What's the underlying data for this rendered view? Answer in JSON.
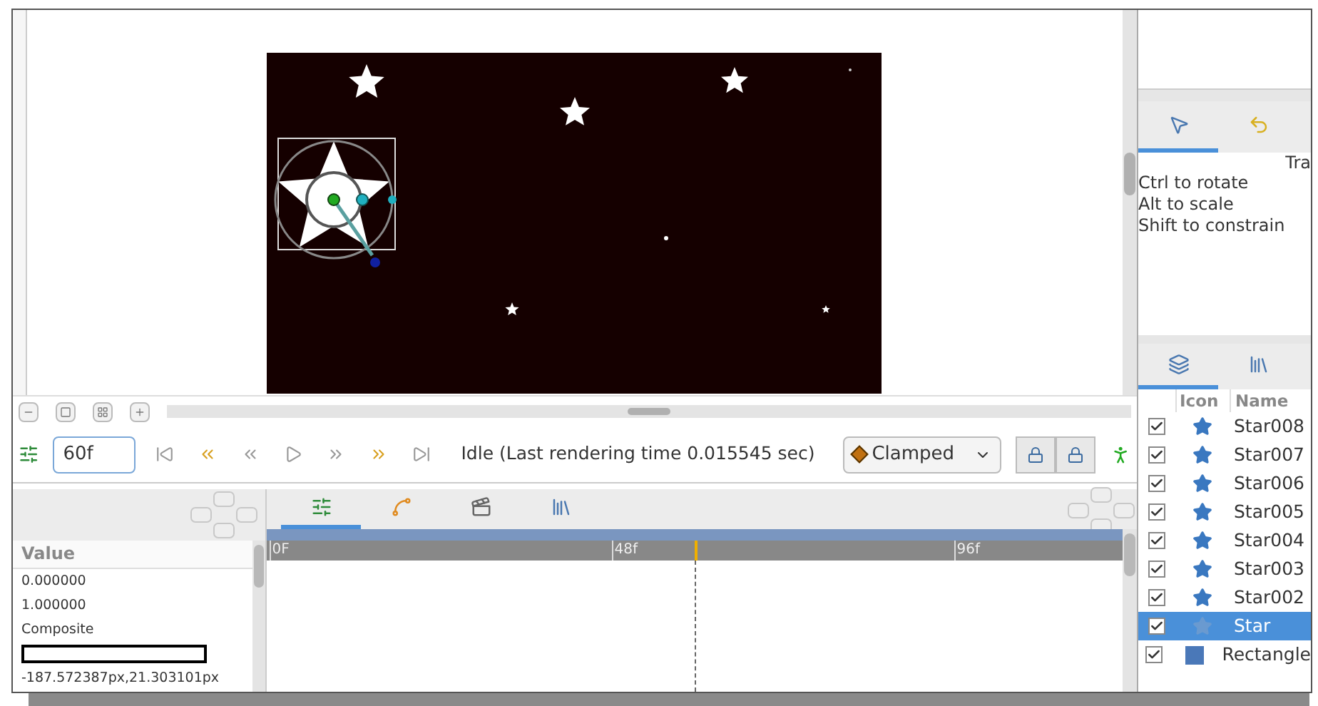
{
  "canvas_toolbar": {
    "time_field": "60f",
    "status": "Idle (Last rendering time 0.015545 sec)",
    "interpolation": "Clamped"
  },
  "params": {
    "header": "Value",
    "rows": [
      {
        "kind": "text",
        "value": "0.000000"
      },
      {
        "kind": "text",
        "value": "1.000000"
      },
      {
        "kind": "text",
        "value": "Composite"
      },
      {
        "kind": "swatch"
      },
      {
        "kind": "text",
        "value": "-187.572387px,21.303101px"
      }
    ]
  },
  "timetrack": {
    "tabs": [
      {
        "kind": "params",
        "selected": true
      },
      {
        "kind": "curves",
        "selected": false
      },
      {
        "kind": "keyframes",
        "selected": false
      },
      {
        "kind": "library",
        "selected": false
      }
    ],
    "ruler_labels": [
      {
        "text": "0F",
        "level": 0
      },
      {
        "text": "48f",
        "level": 0.4
      },
      {
        "text": "96f",
        "level": 0.8
      }
    ],
    "playhead": {
      "level": 0.5
    }
  },
  "tool_options": {
    "tabs": [
      {
        "kind": "pointer",
        "selected": true
      },
      {
        "kind": "undo",
        "selected": false
      }
    ],
    "title": "Tra",
    "hints": [
      "Ctrl to rotate",
      "Alt to scale",
      "Shift to constrain"
    ]
  },
  "layers": {
    "tabs": [
      {
        "kind": "layers",
        "selected": true
      },
      {
        "kind": "library",
        "selected": false
      }
    ],
    "columns": [
      "Icon",
      "Name"
    ],
    "rows": [
      {
        "name": "Star008",
        "kind": "star",
        "checked": true,
        "selected": false
      },
      {
        "name": "Star007",
        "kind": "star",
        "checked": true,
        "selected": false
      },
      {
        "name": "Star006",
        "kind": "star",
        "checked": true,
        "selected": false
      },
      {
        "name": "Star005",
        "kind": "star",
        "checked": true,
        "selected": false
      },
      {
        "name": "Star004",
        "kind": "star",
        "checked": true,
        "selected": false
      },
      {
        "name": "Star003",
        "kind": "star",
        "checked": true,
        "selected": false
      },
      {
        "name": "Star002",
        "kind": "star",
        "checked": true,
        "selected": false
      },
      {
        "name": "Star",
        "kind": "star",
        "checked": true,
        "selected": true
      },
      {
        "name": "Rectangle",
        "kind": "rectangle",
        "checked": true,
        "selected": false
      }
    ]
  }
}
